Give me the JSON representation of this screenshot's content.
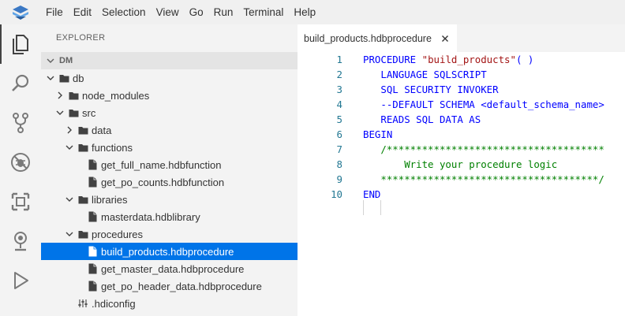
{
  "menu": [
    "File",
    "Edit",
    "Selection",
    "View",
    "Go",
    "Run",
    "Terminal",
    "Help"
  ],
  "activity": [
    {
      "icon": "explorer-icon",
      "active": true
    },
    {
      "icon": "search-icon",
      "active": false
    },
    {
      "icon": "source-control-icon",
      "active": false
    },
    {
      "icon": "debug-icon",
      "active": false
    },
    {
      "icon": "extensions-icon",
      "active": false
    },
    {
      "icon": "remote-explorer-icon",
      "active": false
    },
    {
      "icon": "run-icon",
      "active": false
    }
  ],
  "sidebar": {
    "title": "EXPLORER",
    "section": "DM",
    "tree": [
      {
        "label": "db",
        "type": "folder",
        "open": true,
        "depth": 0
      },
      {
        "label": "node_modules",
        "type": "folder",
        "open": false,
        "depth": 1
      },
      {
        "label": "src",
        "type": "folder",
        "open": true,
        "depth": 1
      },
      {
        "label": "data",
        "type": "folder",
        "open": false,
        "depth": 2
      },
      {
        "label": "functions",
        "type": "folder",
        "open": true,
        "depth": 2
      },
      {
        "label": "get_full_name.hdbfunction",
        "type": "file",
        "depth": 3
      },
      {
        "label": "get_po_counts.hdbfunction",
        "type": "file",
        "depth": 3
      },
      {
        "label": "libraries",
        "type": "folder",
        "open": true,
        "depth": 2
      },
      {
        "label": "masterdata.hdblibrary",
        "type": "file",
        "depth": 3
      },
      {
        "label": "procedures",
        "type": "folder",
        "open": true,
        "depth": 2
      },
      {
        "label": "build_products.hdbprocedure",
        "type": "file",
        "depth": 3,
        "selected": true
      },
      {
        "label": "get_master_data.hdbprocedure",
        "type": "file",
        "depth": 3
      },
      {
        "label": "get_po_header_data.hdbprocedure",
        "type": "file",
        "depth": 3
      },
      {
        "label": ".hdiconfig",
        "type": "config",
        "depth": 2
      }
    ]
  },
  "editor": {
    "tab_label": "build_products.hdbprocedure",
    "lines": [
      {
        "n": "1",
        "parts": [
          {
            "t": "PROCEDURE ",
            "c": "plain"
          },
          {
            "t": "\"build_products\"",
            "c": "str"
          },
          {
            "t": "( )",
            "c": "plain"
          }
        ]
      },
      {
        "n": "2",
        "parts": [
          {
            "t": "   LANGUAGE SQLSCRIPT",
            "c": "plain"
          }
        ]
      },
      {
        "n": "3",
        "parts": [
          {
            "t": "   SQL SECURITY INVOKER",
            "c": "plain"
          }
        ]
      },
      {
        "n": "4",
        "parts": [
          {
            "t": "   --DEFAULT SCHEMA <default_schema_name>",
            "c": "plain"
          }
        ]
      },
      {
        "n": "5",
        "parts": [
          {
            "t": "   READS SQL DATA AS",
            "c": "plain"
          }
        ]
      },
      {
        "n": "6",
        "parts": [
          {
            "t": "BEGIN",
            "c": "plain"
          }
        ]
      },
      {
        "n": "7",
        "parts": [
          {
            "t": "   /*************************************",
            "c": "cmt"
          }
        ]
      },
      {
        "n": "8",
        "parts": [
          {
            "t": "       Write your procedure logic",
            "c": "cmt"
          }
        ]
      },
      {
        "n": "9",
        "parts": [
          {
            "t": "   *************************************/",
            "c": "cmt"
          }
        ]
      },
      {
        "n": "10",
        "parts": [
          {
            "t": "END",
            "c": "plain"
          }
        ]
      }
    ]
  }
}
